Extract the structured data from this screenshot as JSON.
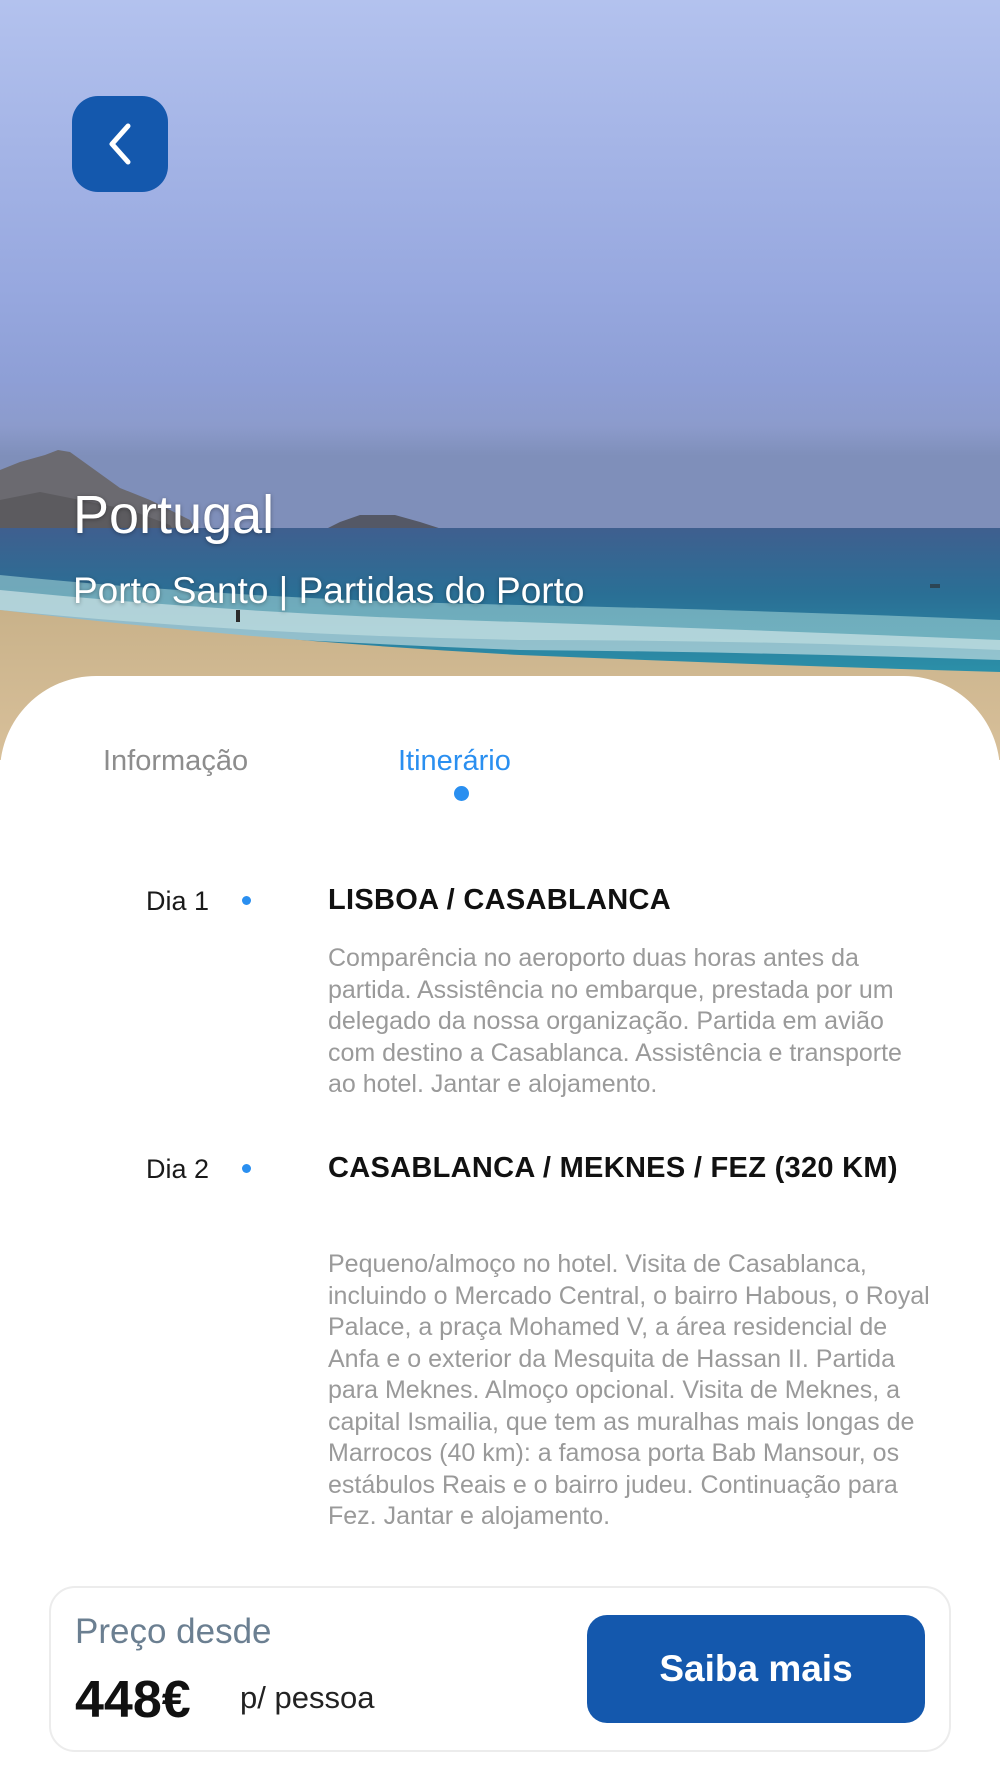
{
  "hero": {
    "title": "Portugal",
    "subtitle": "Porto Santo | Partidas do Porto"
  },
  "icons": {
    "back": "chevron-left-icon"
  },
  "tabs": [
    {
      "label": "Informação",
      "active": false
    },
    {
      "label": "Itinerário",
      "active": true
    }
  ],
  "itinerary": [
    {
      "day": "Dia 1",
      "heading": " LISBOA / CASABLANCA",
      "description": "Comparência no aeroporto duas horas antes da partida. Assistência no embarque, prestada por um delegado da nossa organização. Partida em avião com destino a Casablanca. Assistência e transporte ao hotel. Jantar e alojamento."
    },
    {
      "day": "Dia 2",
      "heading": " CASABLANCA / MEKNES / FEZ (320 KM)",
      "description": "Pequeno/almoço no hotel. Visita de Casablanca, incluindo o Mercado Central, o bairro Habous, o Royal Palace, a praça Mohamed V, a área residencial de Anfa e o exterior da Mesquita de Hassan II. Partida para Meknes. Almoço opcional. Visita de Meknes, a capital Ismailia, que tem as muralhas mais longas de Marrocos (40 km): a famosa porta Bab Mansour, os estábulos Reais e o bairro judeu. Continuação para Fez. Jantar e alojamento."
    }
  ],
  "price": {
    "label": "Preço desde",
    "value": "448€",
    "unit": "p/ pessoa"
  },
  "cta_label": "Saiba mais",
  "colors": {
    "primary": "#1458ad",
    "accent": "#2a8ff0",
    "muted_text": "#9a9a9a"
  }
}
